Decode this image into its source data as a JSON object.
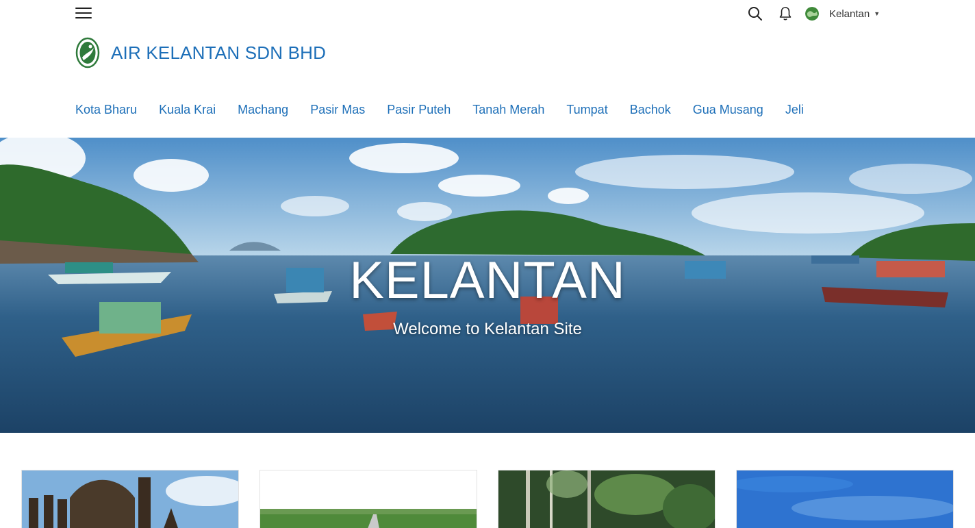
{
  "header": {
    "menu_icon": "hamburger-icon",
    "search_icon": "search-icon",
    "notification_icon": "bell-icon",
    "region_label": "Kelantan",
    "region_icon": "globe-icon"
  },
  "brand": {
    "title": "AIR KELANTAN SDN BHD",
    "logo_icon": "company-logo"
  },
  "nav": {
    "items": [
      {
        "label": "Kota Bharu"
      },
      {
        "label": "Kuala Krai"
      },
      {
        "label": "Machang"
      },
      {
        "label": "Pasir Mas"
      },
      {
        "label": "Pasir Puteh"
      },
      {
        "label": "Tanah Merah"
      },
      {
        "label": "Tumpat"
      },
      {
        "label": "Bachok"
      },
      {
        "label": "Gua Musang"
      },
      {
        "label": "Jeli"
      }
    ]
  },
  "hero": {
    "title": "KELANTAN",
    "subtitle": "Welcome to Kelantan Site"
  },
  "colors": {
    "brand_blue": "#1d6fb8",
    "sea": "#2b5f86",
    "sky": "#5c9bd1"
  }
}
